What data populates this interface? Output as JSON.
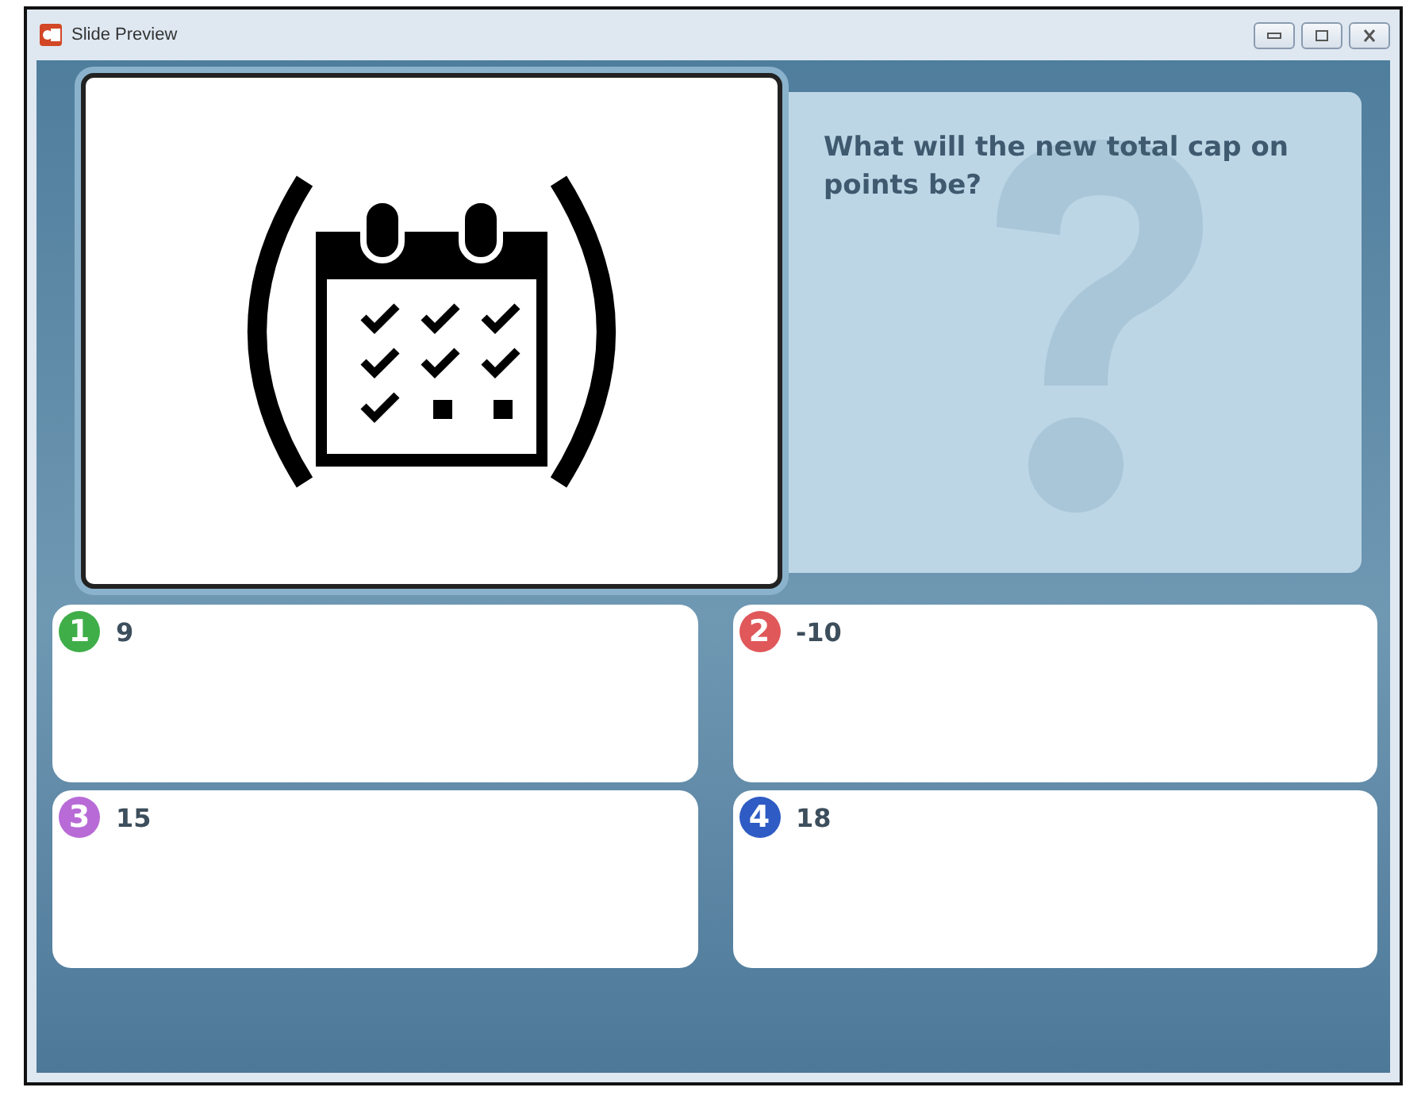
{
  "window": {
    "title": "Slide Preview"
  },
  "question": {
    "text": "What will the new total cap on points be?"
  },
  "answers": [
    {
      "number": "1",
      "text": "9",
      "color": "#3fae49"
    },
    {
      "number": "2",
      "text": "-10",
      "color": "#e0585a"
    },
    {
      "number": "3",
      "text": "15",
      "color": "#b86bd6"
    },
    {
      "number": "4",
      "text": "18",
      "color": "#2e5bc4"
    }
  ]
}
